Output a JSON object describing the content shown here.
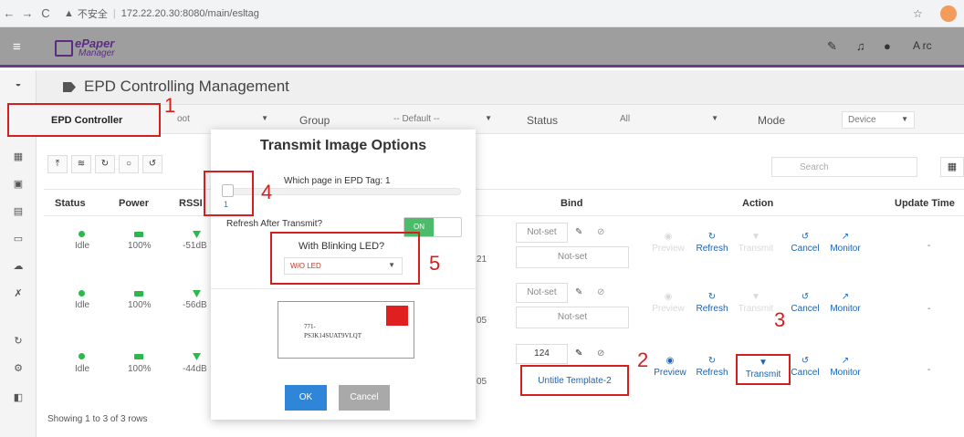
{
  "browser": {
    "security": "不安全",
    "url": "172.22.20.30:8080/main/esltag"
  },
  "app": {
    "logo_line1": "ePaper",
    "logo_line2": "Manager",
    "user_short": "A rc"
  },
  "page": {
    "title": "EPD Controlling Management"
  },
  "filters": {
    "controller_tab": "EPD Controller",
    "controller_value": "oot",
    "group_label": "Group",
    "group_value": "-- Default --",
    "status_label": "Status",
    "status_value": "All",
    "mode_label": "Mode",
    "mode_value": "Device"
  },
  "search": {
    "placeholder": "Search"
  },
  "table": {
    "headers": {
      "status": "Status",
      "power": "Power",
      "rssi": "RSSI",
      "bind": "Bind",
      "action": "Action",
      "update_time": "Update Time"
    },
    "rows": [
      {
        "status": "Idle",
        "power": "100%",
        "rssi": "-51dB",
        "bind_value": "Not-set",
        "bind_template": "Not-set",
        "partial": "21",
        "update": "-"
      },
      {
        "status": "Idle",
        "power": "100%",
        "rssi": "-56dB",
        "bind_value": "Not-set",
        "bind_template": "Not-set",
        "partial": "05",
        "update": "-"
      },
      {
        "status": "Idle",
        "power": "100%",
        "rssi": "-44dB",
        "bind_value": "124",
        "bind_template": "Untitle Template-2",
        "partial": "05",
        "update": "-"
      }
    ],
    "actions": {
      "preview": "Preview",
      "refresh": "Refresh",
      "transmit": "Transmit",
      "cancel": "Cancel",
      "monitor": "Monitor"
    }
  },
  "footer": {
    "text": "Showing 1 to 3 of 3 rows"
  },
  "modal": {
    "title": "Transmit Image Options",
    "page_question": "Which page in EPD Tag: 1",
    "page_value": "1",
    "refresh_question": "Refresh After Transmit?",
    "toggle_on": "ON",
    "led_question": "With Blinking LED?",
    "led_value": "W/O LED",
    "template_text_line1": "771-",
    "template_text_line2": "PS3K14SUAT9VLQT",
    "ok": "OK",
    "cancel": "Cancel"
  },
  "annotations": [
    "1",
    "2",
    "3",
    "4",
    "5"
  ],
  "colors": {
    "accent_purple": "#6b3a8f",
    "annotation_red": "#d41f1f",
    "ok_blue": "#2f86d8",
    "status_green": "#2db84d"
  }
}
